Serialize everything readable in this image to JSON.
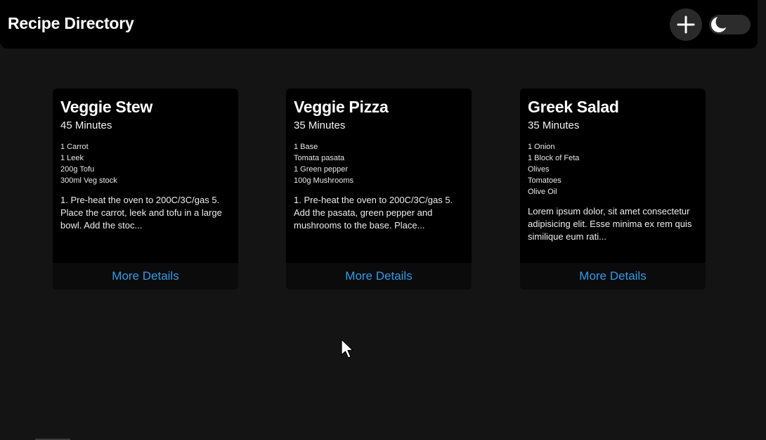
{
  "header": {
    "title": "Recipe Directory",
    "add_icon": "plus-icon",
    "theme_icon": "moon-icon"
  },
  "recipes": [
    {
      "title": "Veggie Stew",
      "time": "45 Minutes",
      "ingredients": [
        "1 Carrot",
        "1 Leek",
        "200g Tofu",
        "300ml Veg stock"
      ],
      "method": "1. Pre-heat the oven to 200C/3C/gas 5. Place the carrot, leek and tofu in a large bowl. Add the stoc...",
      "link": "More Details"
    },
    {
      "title": "Veggie Pizza",
      "time": "35 Minutes",
      "ingredients": [
        "1 Base",
        "Tomata pasata",
        "1 Green pepper",
        "100g Mushrooms"
      ],
      "method": "1. Pre-heat the oven to 200C/3C/gas 5. Add the pasata, green pepper and mushrooms to the base. Place...",
      "link": "More Details"
    },
    {
      "title": "Greek Salad",
      "time": "35 Minutes",
      "ingredients": [
        "1 Onion",
        "1 Block of Feta",
        "Olives",
        "Tomatoes",
        "Olive Oil"
      ],
      "method": "Lorem ipsum dolor, sit amet consectetur adipisicing elit. Esse minima ex rem quis similique eum rati...",
      "link": "More Details"
    }
  ],
  "colors": {
    "background": "#141414",
    "header": "#000000",
    "card": "#000000",
    "link": "#2f9be8"
  }
}
